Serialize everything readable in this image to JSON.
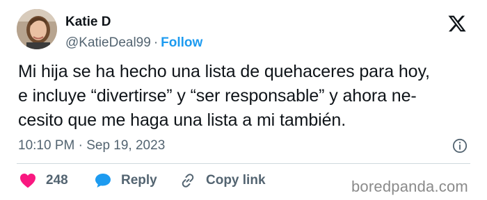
{
  "author": {
    "name": "Katie D",
    "handle": "@KatieDeal99",
    "separator": "·",
    "follow_label": "Follow"
  },
  "tweet": {
    "lines": [
      "Mi hija se ha hecho una lista de quehaceres para hoy,",
      "e incluye “divertirse” y “ser responsable” y ahora ne-",
      "cesito que me haga una lista a mi también."
    ],
    "timestamp": "10:10 PM · Sep 19, 2023"
  },
  "actions": {
    "likes_count": "248",
    "reply_label": "Reply",
    "copy_link_label": "Copy link"
  },
  "watermark": "boredpanda.com",
  "colors": {
    "accent": "#1d9bf0",
    "like": "#f91880",
    "text": "#0f1419",
    "secondary": "#536471",
    "divider": "#cfd9de"
  },
  "icons": {
    "brand": "x-logo-icon",
    "info": "info-icon",
    "like": "heart-icon",
    "reply": "speech-bubble-icon",
    "copy": "link-icon"
  }
}
